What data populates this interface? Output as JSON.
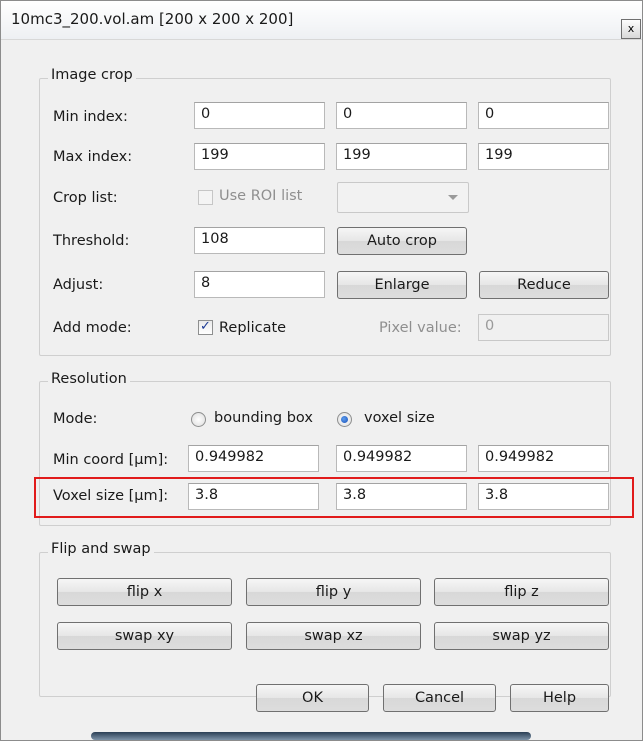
{
  "window": {
    "title": "10mc3_200.vol.am [200 x 200 x 200]",
    "close_glyph": "x"
  },
  "image_crop": {
    "title": "Image crop",
    "min_index": {
      "label": "Min index:",
      "values": [
        "0",
        "0",
        "0"
      ]
    },
    "max_index": {
      "label": "Max index:",
      "values": [
        "199",
        "199",
        "199"
      ]
    },
    "crop_list": {
      "label": "Crop list:",
      "checkbox_label": "Use ROI list",
      "checked": false,
      "enabled": false
    },
    "threshold": {
      "label": "Threshold:",
      "value": "108",
      "button": "Auto crop"
    },
    "adjust": {
      "label": "Adjust:",
      "value": "8",
      "enlarge_button": "Enlarge",
      "reduce_button": "Reduce"
    },
    "add_mode": {
      "label": "Add mode:",
      "checkbox_label": "Replicate",
      "checked": true,
      "pixel_value_label": "Pixel value:",
      "pixel_value": "0"
    }
  },
  "resolution": {
    "title": "Resolution",
    "mode": {
      "label": "Mode:",
      "options": [
        "bounding box",
        "voxel size"
      ],
      "selected": "voxel size"
    },
    "min_coord": {
      "label": "Min coord [µm]:",
      "values": [
        "0.949982",
        "0.949982",
        "0.949982"
      ]
    },
    "voxel_size": {
      "label": "Voxel size [µm]:",
      "values": [
        "3.8",
        "3.8",
        "3.8"
      ]
    },
    "highlight_color": "#e11b1b"
  },
  "flip_swap": {
    "title": "Flip and swap",
    "buttons": [
      "flip x",
      "flip y",
      "flip z",
      "swap xy",
      "swap xz",
      "swap yz"
    ]
  },
  "footer": {
    "ok": "OK",
    "cancel": "Cancel",
    "help": "Help"
  },
  "icons": {
    "checkmark": "check-icon",
    "dropdown": "chevron-down-icon",
    "close": "close-icon"
  }
}
